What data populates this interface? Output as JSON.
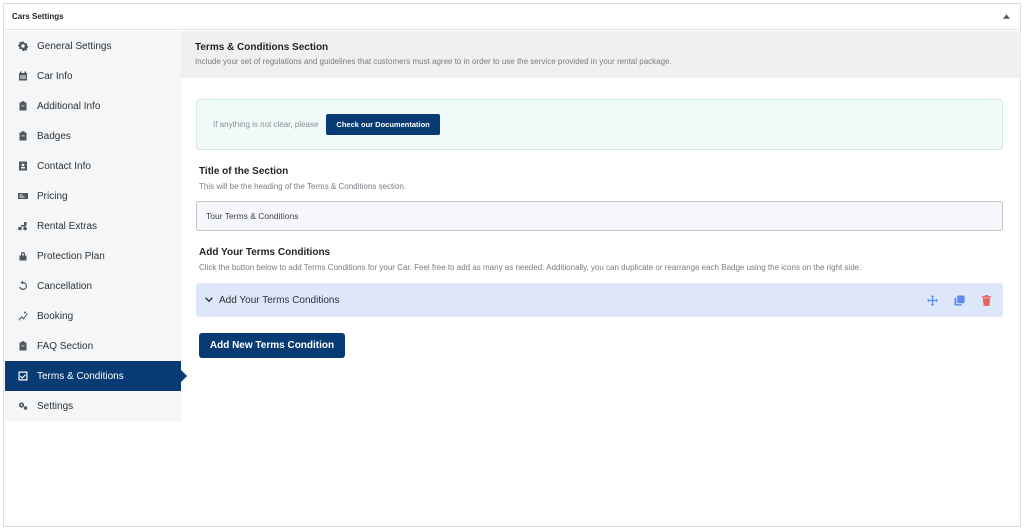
{
  "panel": {
    "title": "Cars Settings"
  },
  "sidebar": {
    "items": [
      {
        "label": "General Settings",
        "icon": "gear-icon"
      },
      {
        "label": "Car Info",
        "icon": "calendar-icon"
      },
      {
        "label": "Additional Info",
        "icon": "clipboard-icon"
      },
      {
        "label": "Badges",
        "icon": "clipboard-icon"
      },
      {
        "label": "Contact Info",
        "icon": "contact-card-icon"
      },
      {
        "label": "Pricing",
        "icon": "money-icon"
      },
      {
        "label": "Rental Extras",
        "icon": "extras-icon"
      },
      {
        "label": "Protection Plan",
        "icon": "lock-icon"
      },
      {
        "label": "Cancellation",
        "icon": "undo-icon"
      },
      {
        "label": "Booking",
        "icon": "booking-icon"
      },
      {
        "label": "FAQ Section",
        "icon": "clipboard-icon"
      },
      {
        "label": "Terms & Conditions",
        "icon": "checkbox-icon",
        "active": true
      },
      {
        "label": "Settings",
        "icon": "gears-icon"
      }
    ]
  },
  "section": {
    "title": "Terms & Conditions Section",
    "description": "Include your set of regulations and guidelines that customers must agree to in order to use the service provided in your rental package."
  },
  "doc_notice": {
    "text": "If anything is not clear, please",
    "button_label": "Check our Documentation"
  },
  "title_field": {
    "label": "Title of the Section",
    "description": "This will be the heading of the Terms & Conditions section.",
    "value": "Tour Terms & Conditions"
  },
  "terms": {
    "label": "Add Your Terms Conditions",
    "description": "Click the button below to add Terms Conditions for your Car. Feel free to add as many as needed. Additionally, you can duplicate or rearrange each Badge using the icons on the right side.",
    "accordion_label": "Add Your Terms Conditions",
    "add_button_label": "Add New Terms Condition"
  },
  "colors": {
    "accent": "#073b74",
    "accordion_bg": "#dde7f9",
    "delete_icon": "#e8615a",
    "move_icon": "#5b8def"
  }
}
